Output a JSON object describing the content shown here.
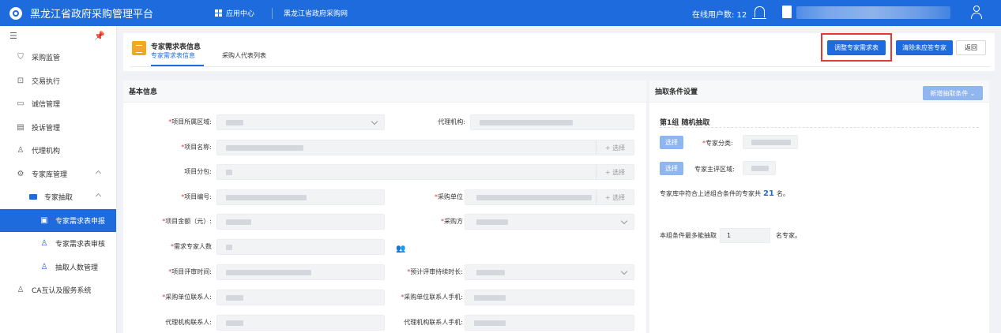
{
  "topbar": {
    "title": "黑龙江省政府采购管理平台",
    "app_center": "应用中心",
    "portal_link": "黑龙江省政府采购网",
    "online_users_label": "在线用户数: 12"
  },
  "sidebar": {
    "items": [
      {
        "label": "采购监管"
      },
      {
        "label": "交易执行"
      },
      {
        "label": "诚信管理"
      },
      {
        "label": "投诉管理"
      },
      {
        "label": "代理机构"
      },
      {
        "label": "专家库管理"
      },
      {
        "label": "专家抽取"
      },
      {
        "label": "专家需求表申报"
      },
      {
        "label": "专家需求表审核"
      },
      {
        "label": "抽取人数管理"
      },
      {
        "label": "CA互认及服务系统"
      }
    ]
  },
  "header": {
    "title": "专家需求表信息",
    "tabs": [
      "专家需求表信息",
      "采购人代表列表"
    ],
    "buttons": {
      "adjust": "调整专家需求表",
      "clear": "清除未应答专家",
      "back": "返回"
    }
  },
  "basic_info": {
    "title": "基本信息",
    "labels": {
      "region": "项目所属区域:",
      "agency": "代理机构:",
      "project_name": "项目名称:",
      "subpackage": "项目分包:",
      "project_no": "项目编号:",
      "purchaser": "采购单位",
      "amount": "项目金额（元）:",
      "method": "采购方",
      "expert_count": "需求专家人数",
      "review_time": "项目评审时间:",
      "duration": "预计评审持续时长:",
      "purchaser_contact": "采购单位联系人:",
      "purchaser_phone": "采购单位联系人手机:",
      "agency_contact": "代理机构联系人:",
      "agency_phone": "代理机构联系人手机:"
    },
    "select_label": "+ 选择"
  },
  "extraction": {
    "title": "抽取条件设置",
    "new_button": "新增抽取条件",
    "group_title": "第1组  随机抽取",
    "choose": "选择",
    "expert_category": "专家分类:",
    "expert_region": "专家主评区域:",
    "match_text_prefix": "专家库中符合上述组合条件的专家共",
    "match_count": "21",
    "match_text_suffix": "名。",
    "max_prefix": "本组条件最多能抽取",
    "max_value": "1",
    "max_suffix": "名专家。"
  },
  "colors": {
    "primary": "#1d6bdc",
    "highlight": "#e53935",
    "required": "#e53935"
  }
}
